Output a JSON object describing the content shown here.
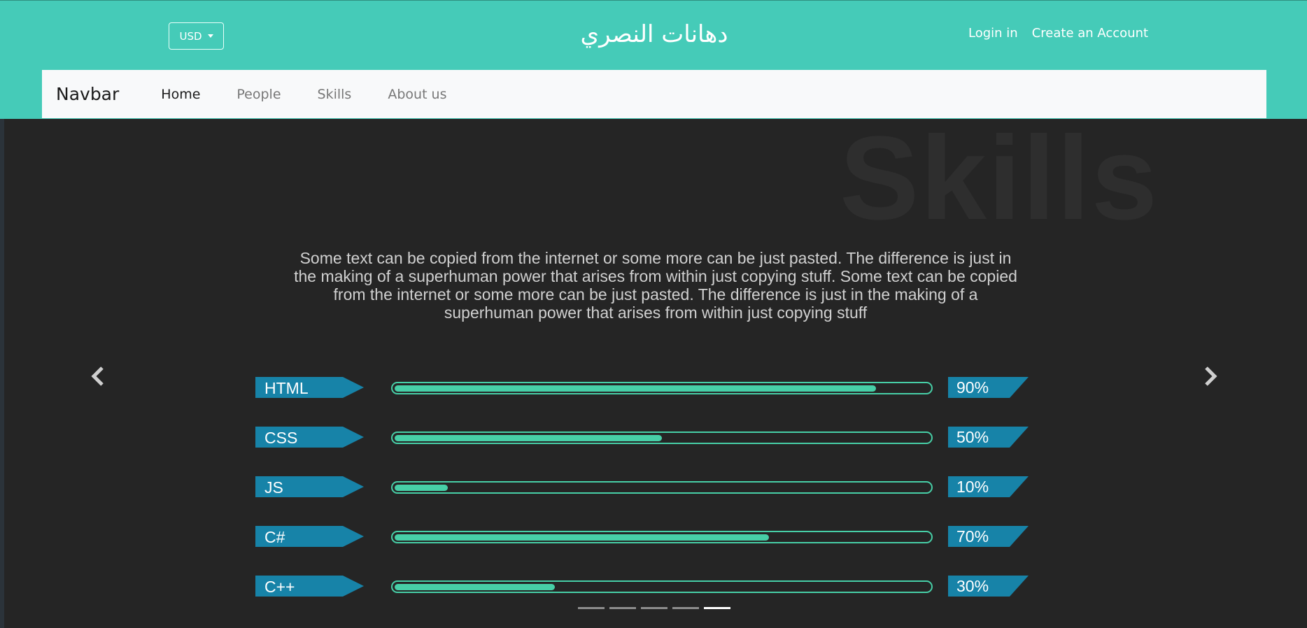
{
  "header": {
    "currency": "USD",
    "site_title": "دهانات النصري",
    "login_label": "Login in",
    "create_account_label": "Create an Account"
  },
  "navbar": {
    "brand": "Navbar",
    "items": [
      {
        "label": "Home",
        "active": true
      },
      {
        "label": "People",
        "active": false
      },
      {
        "label": "Skills",
        "active": false
      },
      {
        "label": "About us",
        "active": false
      }
    ]
  },
  "section": {
    "background_word": "Skills",
    "description": "Some text can be copied from the internet or some more can be just pasted. The difference is just in the making of a superhuman power that arises from within just copying stuff. Some text can be copied from the internet or some more can be just pasted. The difference is just in the making of a superhuman power that arises from within just copying stuff"
  },
  "skills": [
    {
      "name": "HTML",
      "percent": 90,
      "label": "90%"
    },
    {
      "name": "CSS",
      "percent": 50,
      "label": "50%"
    },
    {
      "name": "JS",
      "percent": 10,
      "label": "10%"
    },
    {
      "name": "C#",
      "percent": 70,
      "label": "70%"
    },
    {
      "name": "C++",
      "percent": 30,
      "label": "30%"
    }
  ],
  "carousel": {
    "indicator_count": 5,
    "active_index": 4
  },
  "colors": {
    "header_bg": "#45cbb8",
    "tag_bg": "#1783a8",
    "bar": "#47cfa7"
  }
}
